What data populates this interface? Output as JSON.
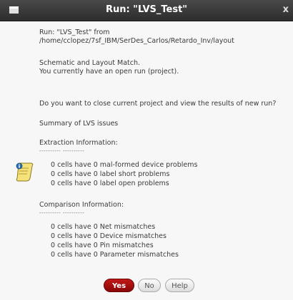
{
  "window": {
    "title": "Run: \"LVS_Test\"",
    "close_glyph": "x"
  },
  "message": {
    "run_line1": "Run: \"LVS_Test\" from",
    "run_line2": "/home/cclopez/7sf_IBM/SerDes_Carlos/Retardo_Inv/layout",
    "match_line": "Schematic and Layout Match.",
    "open_run_line": "You currently have an open run (project).",
    "question": "Do you want to close current project and view the results of new run?",
    "summary_title": "Summary of LVS issues"
  },
  "extraction": {
    "title": "Extraction Information:",
    "separator": "---------- ----------",
    "items": [
      "0 cells have 0 mal-formed device problems",
      "0 cells have 0 label short problems",
      "0 cells have 0 label open problems"
    ]
  },
  "comparison": {
    "title": "Comparison Information:",
    "separator": "---------- ----------",
    "items": [
      "0 cells have 0 Net mismatches",
      "0 cells have 0 Device mismatches",
      "0 cells have 0 Pin mismatches",
      "0 cells have 0 Parameter mismatches"
    ]
  },
  "buttons": {
    "yes": "Yes",
    "no": "No",
    "help": "Help"
  },
  "icons": {
    "window": "window-menu-icon",
    "info": "info-scroll-icon"
  },
  "colors": {
    "titlebar": "#333333",
    "yes_button": "#a80f0f",
    "info_icon_fill": "#f5e27a"
  }
}
